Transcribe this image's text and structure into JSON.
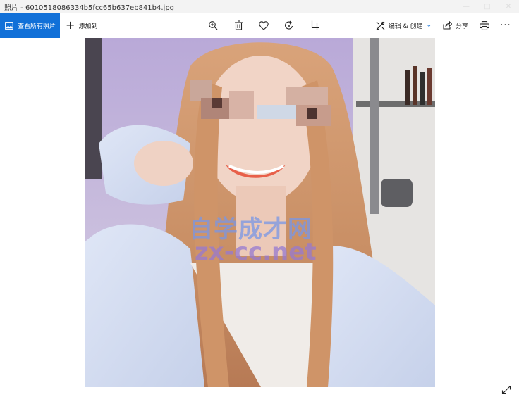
{
  "window": {
    "title": "照片 - 6010518086334b5fcc65b637eb841b4.jpg"
  },
  "toolbar": {
    "view_all_label": "查看所有照片",
    "add_to_label": "添加到",
    "edit_create_label": "编辑 & 创建",
    "share_label": "分享"
  },
  "watermark": {
    "line1": "自学成才网",
    "line2": "zx-cc.net"
  },
  "colors": {
    "accent": "#1170d8"
  }
}
